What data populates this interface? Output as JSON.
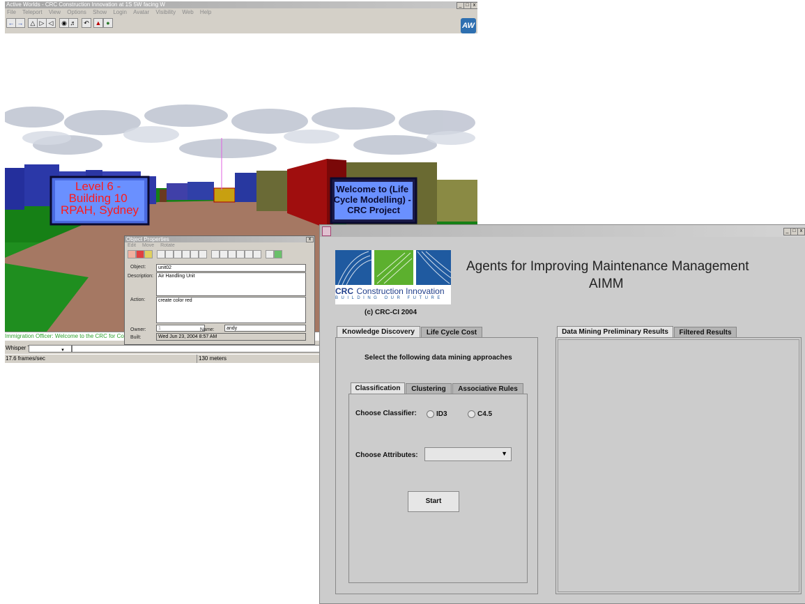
{
  "aw": {
    "title": "Active Worlds - CRC Construction Innovation at 1S 5W facing W",
    "menu": [
      "File",
      "Teleport",
      "View",
      "Options",
      "Show",
      "Login",
      "Avatar",
      "Visibility",
      "Web",
      "Help"
    ],
    "sign_left": "Level 6 - Building 10 RPAH, Sydney",
    "sign_right": "Welcome to (Life Cycle Modelling) - CRC Project",
    "chat": "Immigration Officer:     Welcome to the CRC for Cor",
    "whisper_label": "Whisper To",
    "status_fps": "17.6 frames/sec",
    "status_distance": "130 meters",
    "logo": "AW"
  },
  "object_properties": {
    "title": "Object Properties",
    "menu": [
      "Edit",
      "Move",
      "Rotate"
    ],
    "object_label": "Object:",
    "object_value": "unit02",
    "description_label": "Description:",
    "description_value": "Air Handling Unit",
    "action_label": "Action:",
    "action_value": "create color red",
    "owner_label": "Owner:",
    "owner_value": "1",
    "name_label": "Name:",
    "name_value": "andy",
    "built_label": "Built:",
    "built_value": "Wed Jun 23, 2004 8:57 AM"
  },
  "aimm": {
    "logo_text_1": "CRC",
    "logo_text_2": "Construction Innovation",
    "logo_tagline": "BUILDING OUR FUTURE",
    "heading_line1": "Agents for Improving Maintenance Management",
    "heading_line2": "AIMM",
    "copyright": "(c) CRC-CI 2004",
    "left_tabs": [
      "Knowledge Discovery",
      "Life Cycle Cost"
    ],
    "instruction": "Select the following data mining approaches",
    "inner_tabs": [
      "Classification",
      "Clustering",
      "Associative Rules"
    ],
    "classifier_label": "Choose Classifier:",
    "classifier_options": [
      "ID3",
      "C4.5"
    ],
    "attributes_label": "Choose Attributes:",
    "attributes_value": "",
    "start_label": "Start",
    "right_tabs": [
      "Data Mining Preliminary Results",
      "Filtered Results"
    ]
  }
}
